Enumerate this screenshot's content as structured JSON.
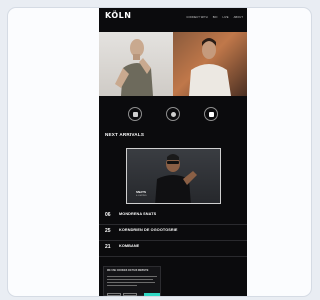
{
  "site": {
    "logo": "KÖLN",
    "nav": [
      "CONNECT WITH",
      "BIO",
      "LIVE",
      "ABOUT"
    ],
    "icon_labels": [
      "",
      "",
      ""
    ],
    "section_title": "NEXT ARRIVALS",
    "feature": {
      "title": "SNATS",
      "subtitle": "& LIMITED"
    },
    "events": [
      {
        "day": "06",
        "month": "",
        "title": "MONDRENA SNATS",
        "subtitle": ""
      },
      {
        "day": "25",
        "month": "",
        "title": "KORNDRIEN DE OGOOTOSRIE",
        "subtitle": ""
      },
      {
        "day": "21",
        "month": "",
        "title": "KOMBANE",
        "subtitle": ""
      }
    ],
    "cookie": {
      "title": "WE USE COOKIES ON THIS WEBSITE",
      "accept": "",
      "reject": "",
      "settings": ""
    }
  },
  "colors": {
    "accent": "#2fd7c3",
    "page_bg": "#0b0b0d",
    "canvas_bg": "#e9edf3"
  }
}
